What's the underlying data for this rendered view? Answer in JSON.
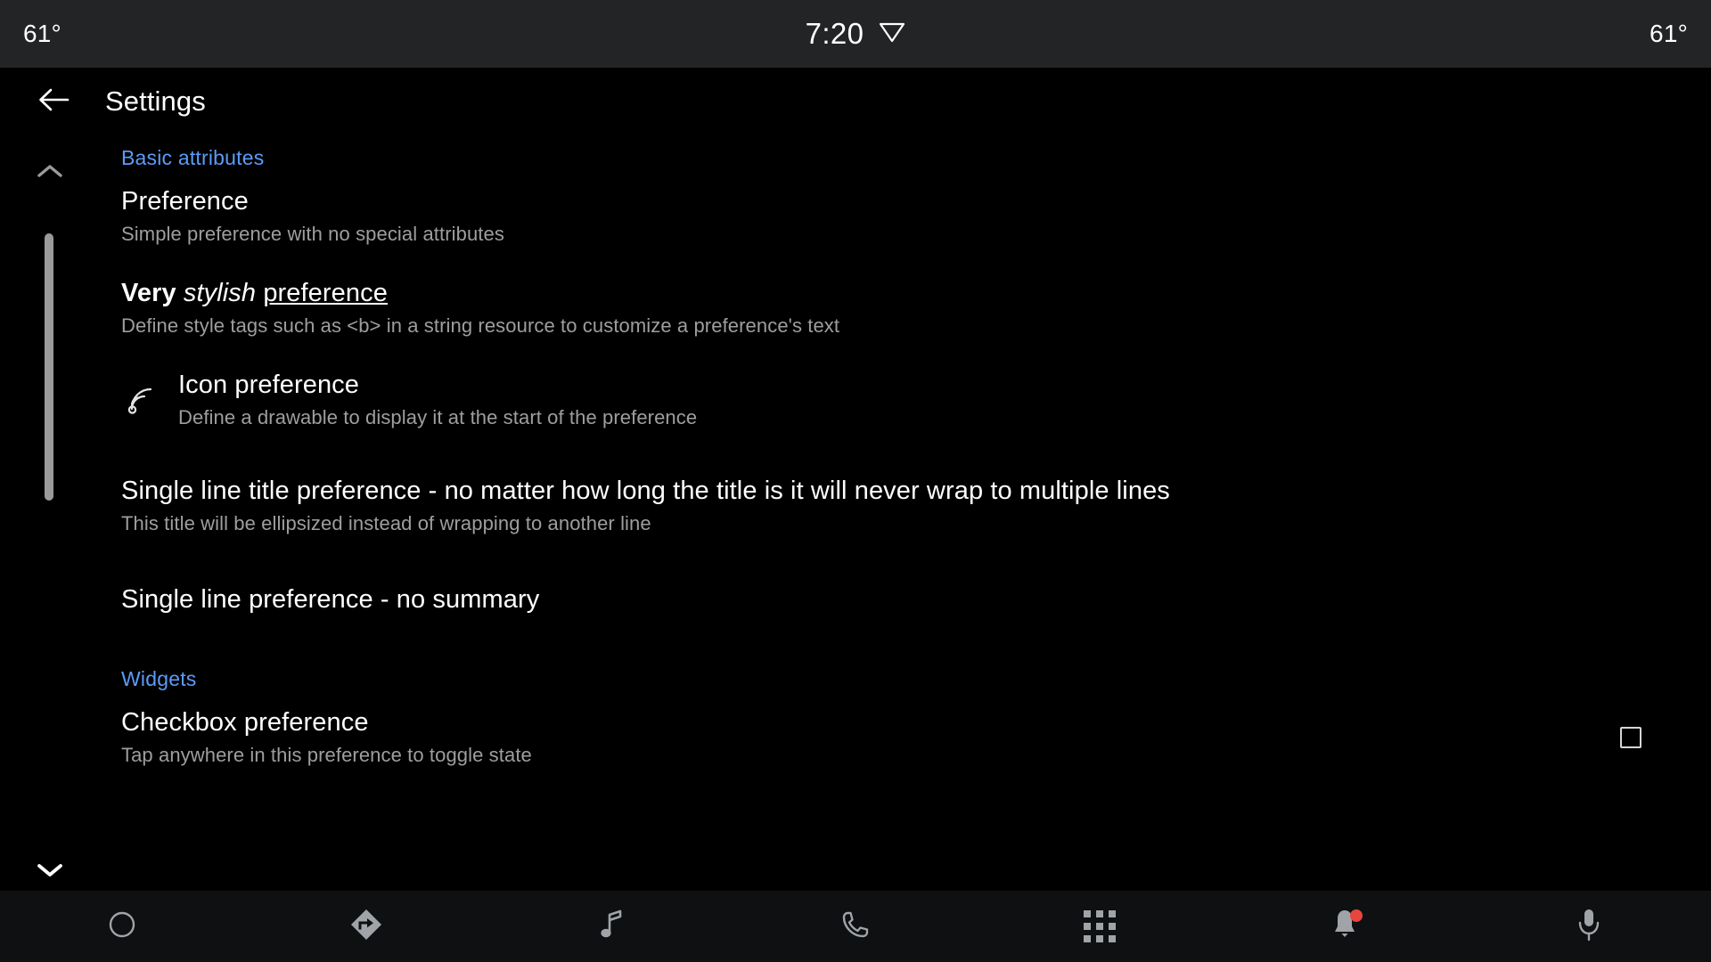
{
  "status_bar": {
    "temp_left": "61°",
    "temp_right": "61°",
    "clock": "7:20",
    "wifi_icon": "wifi-icon",
    "background_color": "#232425"
  },
  "toolbar": {
    "back_icon": "back-arrow-icon",
    "title": "Settings"
  },
  "scroll": {
    "up_icon": "chevron-up-icon",
    "down_icon": "chevron-down-icon",
    "thumb_name": "scrollbar-thumb"
  },
  "accent_color": "#5B9BF8",
  "sections": [
    {
      "header": "Basic attributes",
      "items": [
        {
          "title": "Preference",
          "summary": "Simple preference with no special attributes",
          "icon": null,
          "widget": null
        },
        {
          "title_rich": [
            {
              "text": "Very",
              "style": "bold"
            },
            {
              "text": " ",
              "style": "normal"
            },
            {
              "text": "stylish",
              "style": "italic"
            },
            {
              "text": " ",
              "style": "normal"
            },
            {
              "text": "preference",
              "style": "underline"
            }
          ],
          "summary": "Define style tags such as <b> in a string resource to customize a preference's text",
          "icon": null,
          "widget": null
        },
        {
          "title": "Icon preference",
          "summary": "Define a drawable to display it at the start of the preference",
          "icon": "wifi-signal-icon",
          "widget": null
        },
        {
          "title": "Single line title preference - no matter how long the title is it will never wrap to multiple lines",
          "summary": "This title will be ellipsized instead of wrapping to another line",
          "icon": null,
          "widget": null,
          "single_line": true
        },
        {
          "title": "Single line preference - no summary",
          "summary": null,
          "icon": null,
          "widget": null
        }
      ]
    },
    {
      "header": "Widgets",
      "items": [
        {
          "title": "Checkbox preference",
          "summary": "Tap anywhere in this preference to toggle state",
          "icon": null,
          "widget": {
            "type": "checkbox",
            "checked": false
          }
        }
      ]
    }
  ],
  "nav_bar": {
    "background_color": "#0e1012",
    "items": [
      {
        "name": "home-icon",
        "badge": false
      },
      {
        "name": "navigation-icon",
        "badge": false
      },
      {
        "name": "music-note-icon",
        "badge": false
      },
      {
        "name": "phone-icon",
        "badge": false
      },
      {
        "name": "apps-grid-icon",
        "badge": false
      },
      {
        "name": "notification-bell-icon",
        "badge": true
      },
      {
        "name": "microphone-icon",
        "badge": false
      }
    ],
    "badge_color": "#e8453c"
  }
}
